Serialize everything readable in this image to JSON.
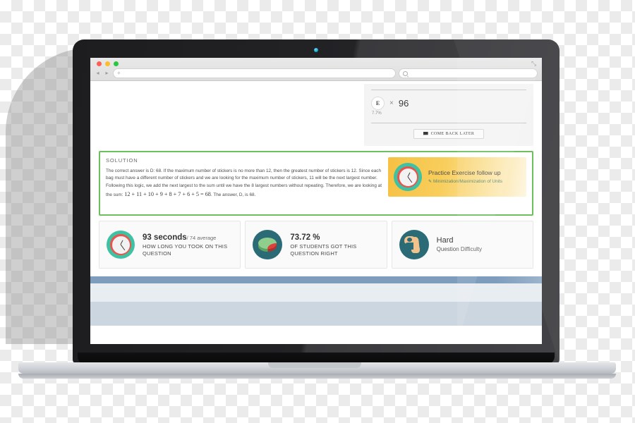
{
  "browser": {
    "traffic_lights": [
      "close-red",
      "minimize-yellow",
      "maximize-green"
    ],
    "back_glyph": "◂",
    "forward_glyph": "▸",
    "url_value": "+",
    "search_placeholder": "",
    "expand_glyph": "⤡"
  },
  "question_panel": {
    "choice_letter": "E",
    "times_glyph": "×",
    "selected_count": "96",
    "percent": "7.7%",
    "come_back_later": "COME BACK LATER"
  },
  "solution": {
    "title": "SOLUTION",
    "body": "The correct answer is D: 68. If the maximum number of stickers is no more than 12, then the greatest number of stickers is 12. Since each bag must have a different number of stickers and we are looking for the maximum number of stickers, 11 will be the next largest number. Following this logic, we add the next largest to the sum until we have the 8 largest numbers without repeating. Therefore, we are looking at the sum:",
    "formula": "12 + 11 + 10 + 9 + 8 + 7 + 6 + 5 = 68",
    "closing": ". The answer, D, is 68.",
    "border_color": "#6dbf5f"
  },
  "practice": {
    "title": "Practice Exercise follow up",
    "pencil_glyph": "✎",
    "subtitle": "Minimization/Maximization of Units",
    "bg_color": "#f6c143"
  },
  "stats": [
    {
      "icon": "clock-icon",
      "value": "93 seconds",
      "value_suffix": "/ 74 average",
      "caption": "HOW LONG YOU TOOK ON THIS QUESTION"
    },
    {
      "icon": "pie-chart-icon",
      "value": "73.72 %",
      "caption": "OF STUDENTS GOT THIS QUESTION RIGHT"
    },
    {
      "icon": "bicep-icon",
      "value": "Hard",
      "caption": "Question Difficulty"
    }
  ],
  "footer": {
    "bar_color": "#7e9dbd"
  }
}
